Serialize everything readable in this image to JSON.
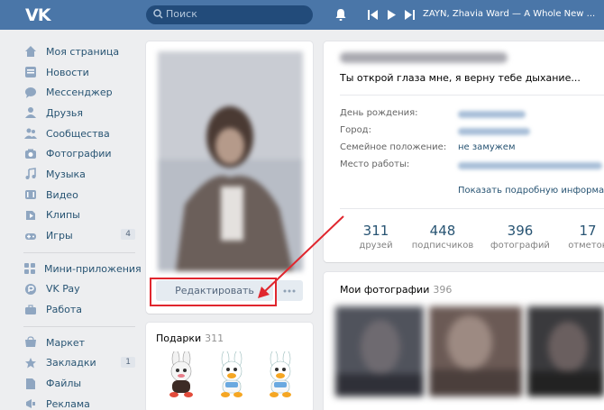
{
  "header": {
    "logo": "VK",
    "search_placeholder": "Поиск",
    "now_playing": "ZAYN, Zhavia Ward — A Whole New ..."
  },
  "sidebar": {
    "items": [
      {
        "label": "Моя страница",
        "icon": "home-icon"
      },
      {
        "label": "Новости",
        "icon": "news-icon"
      },
      {
        "label": "Мессенджер",
        "icon": "messenger-icon"
      },
      {
        "label": "Друзья",
        "icon": "friends-icon"
      },
      {
        "label": "Сообщества",
        "icon": "communities-icon"
      },
      {
        "label": "Фотографии",
        "icon": "camera-icon"
      },
      {
        "label": "Музыка",
        "icon": "music-icon"
      },
      {
        "label": "Видео",
        "icon": "video-icon"
      },
      {
        "label": "Клипы",
        "icon": "clips-icon"
      },
      {
        "label": "Игры",
        "icon": "games-icon",
        "count": "4"
      }
    ],
    "items2": [
      {
        "label": "Мини-приложения",
        "icon": "apps-icon"
      },
      {
        "label": "VK Pay",
        "icon": "vkpay-icon"
      },
      {
        "label": "Работа",
        "icon": "briefcase-icon"
      }
    ],
    "items3": [
      {
        "label": "Маркет",
        "icon": "market-icon"
      },
      {
        "label": "Закладки",
        "icon": "bookmark-icon",
        "count": "1"
      },
      {
        "label": "Файлы",
        "icon": "files-icon"
      },
      {
        "label": "Реклама",
        "icon": "ads-icon"
      }
    ]
  },
  "profile": {
    "edit_label": "Редактировать",
    "status": "Ты открой глаза мне, я верну тебе дыхание...",
    "fields": [
      {
        "label": "День рождения:"
      },
      {
        "label": "Город:"
      },
      {
        "label": "Семейное положение:",
        "value": "не замужем"
      },
      {
        "label": "Место работы:"
      }
    ],
    "show_more": "Показать подробную информацию",
    "stats": [
      {
        "num": "311",
        "label": "друзей"
      },
      {
        "num": "448",
        "label": "подписчиков"
      },
      {
        "num": "396",
        "label": "фотографий"
      },
      {
        "num": "17",
        "label": "отметок"
      }
    ]
  },
  "photos": {
    "title": "Мои фотографии",
    "count": "396"
  },
  "gifts": {
    "title": "Подарки",
    "count": "311"
  },
  "colors": {
    "header": "#4a76a8",
    "link": "#285473",
    "highlight": "#e0262e"
  }
}
